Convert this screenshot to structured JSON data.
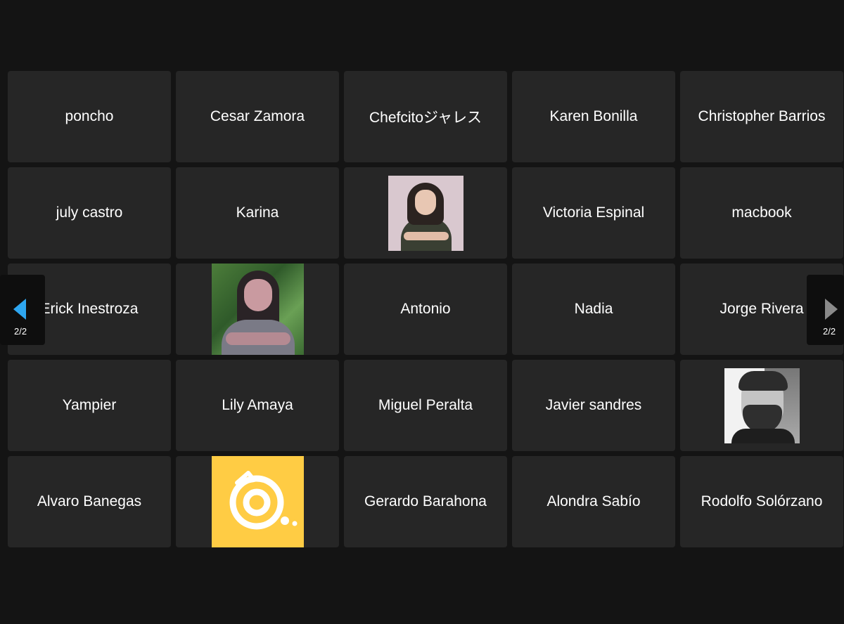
{
  "participants": [
    {
      "type": "name",
      "name": "poncho"
    },
    {
      "type": "name",
      "name": "Cesar Zamora"
    },
    {
      "type": "name",
      "name": "Chefcitoジャレス"
    },
    {
      "type": "name",
      "name": "Karen Bonilla"
    },
    {
      "type": "name",
      "name": "Christopher Barrios"
    },
    {
      "type": "name",
      "name": "july castro"
    },
    {
      "type": "name",
      "name": "Karina"
    },
    {
      "type": "avatar",
      "avatar": "photo-woman"
    },
    {
      "type": "name",
      "name": "Victoria Espinal"
    },
    {
      "type": "name",
      "name": "macbook"
    },
    {
      "type": "name",
      "name": "Erick Inestroza"
    },
    {
      "type": "avatar",
      "avatar": "photo-green"
    },
    {
      "type": "name",
      "name": "Antonio"
    },
    {
      "type": "name",
      "name": "Nadia"
    },
    {
      "type": "name",
      "name": "Jorge Rivera"
    },
    {
      "type": "name",
      "name": "Yampier"
    },
    {
      "type": "name",
      "name": "Lily Amaya"
    },
    {
      "type": "name",
      "name": "Miguel Peralta"
    },
    {
      "type": "name",
      "name": "Javier sandres"
    },
    {
      "type": "avatar",
      "avatar": "photo-bw"
    },
    {
      "type": "name",
      "name": "Alvaro Banegas"
    },
    {
      "type": "avatar",
      "avatar": "logo-yellow"
    },
    {
      "type": "name",
      "name": "Gerardo Barahona"
    },
    {
      "type": "name",
      "name": "Alondra Sabío"
    },
    {
      "type": "name",
      "name": "Rodolfo Solórzano"
    }
  ],
  "pagination": {
    "prev_label": "2/2",
    "next_label": "2/2"
  },
  "colors": {
    "background": "#141414",
    "tile": "#262626",
    "accent_arrow": "#2ea6f0",
    "inactive_arrow": "#8a8a8a",
    "logo_yellow": "#ffcc44"
  },
  "icons": {
    "prev": "left-triangle-icon",
    "next": "right-triangle-icon"
  }
}
